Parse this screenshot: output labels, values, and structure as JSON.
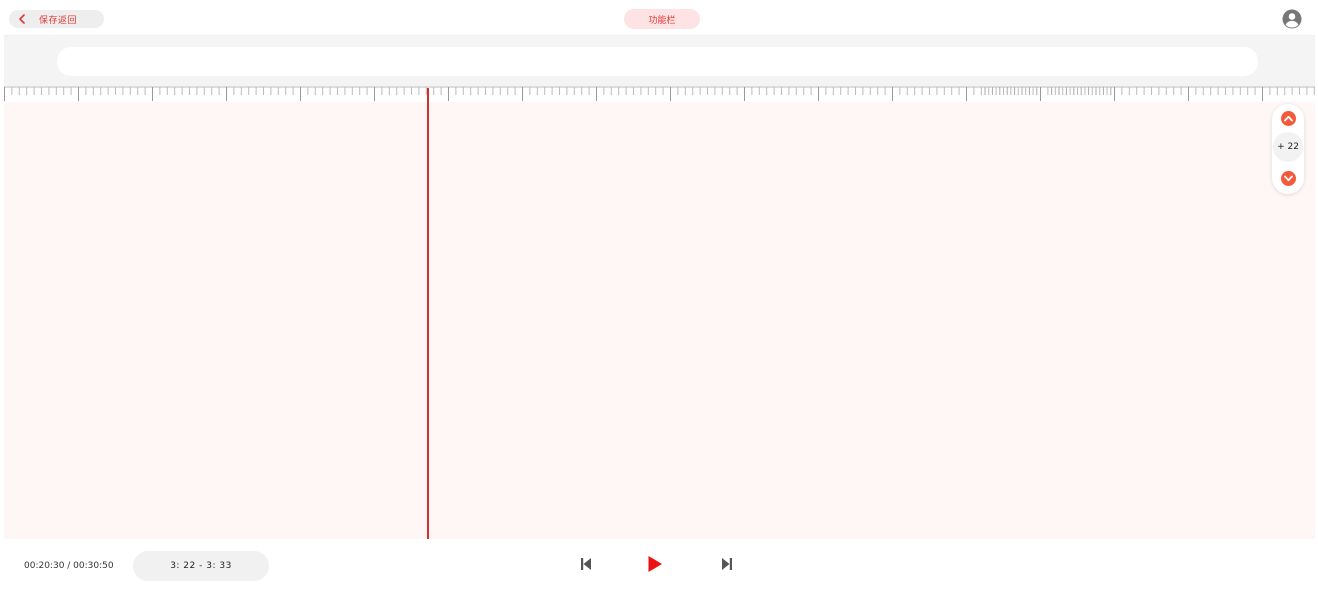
{
  "header": {
    "back_label": "保存返回",
    "function_bar_label": "功能栏",
    "user_icon": "user-circle-icon"
  },
  "search": {
    "value": "",
    "placeholder": ""
  },
  "zoom": {
    "value": "+ 22",
    "up_icon": "chevron-up-icon",
    "down_icon": "chevron-down-icon"
  },
  "playback": {
    "time_display": "00:20:30 / 00:30:50",
    "range_display": "3: 22 - 3: 33",
    "prev_icon": "skip-previous-icon",
    "play_icon": "play-icon",
    "next_icon": "skip-next-icon"
  },
  "colors": {
    "accent": "#e53935",
    "accent_light": "#fde3e3",
    "playhead": "#d32f2f",
    "zoom_button": "#f25a3a",
    "canvas_bg": "#fff7f6"
  }
}
